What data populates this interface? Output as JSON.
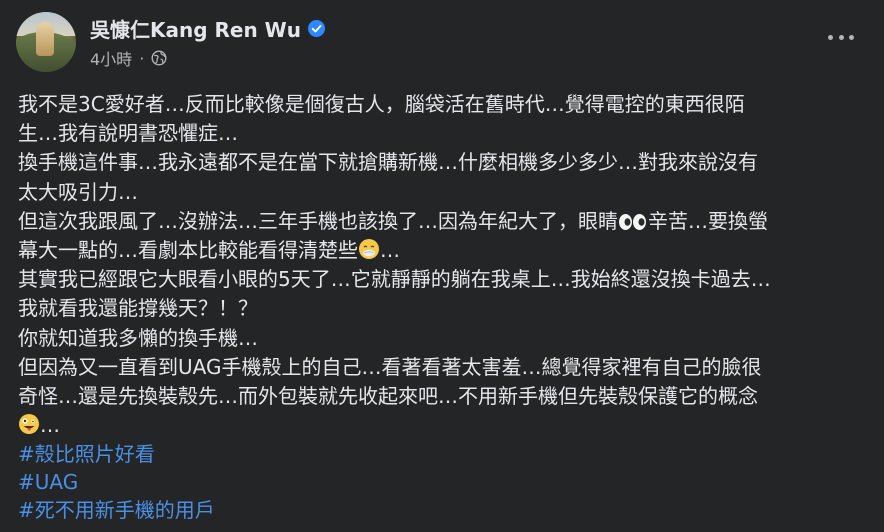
{
  "post": {
    "author": "吳慷仁Kang Ren Wu",
    "verified_icon": "verified-badge-icon",
    "timestamp": "4小時",
    "separator": "·",
    "audience_icon": "globe-icon",
    "more_icon": "more-options-icon",
    "lines": [
      "我不是3C愛好者…反而比較像是個復古人，腦袋活在舊時代…覺得電控的東西很陌",
      "生…我有說明書恐懼症…",
      "換手機這件事…我永遠都不是在當下就搶購新機…什麼相機多少多少…對我來說沒有",
      "太大吸引力…",
      "但這次我跟風了…沒辦法…三年手機也該換了…因為年紀大了，眼睛",
      "辛苦…要換螢",
      "幕大一點的…看劇本比較能看得清楚些",
      "…",
      "其實我已經跟它大眼看小眼的5天了…它就靜靜的躺在我桌上…我始終還沒換卡過去…",
      "我就看我還能撐幾天？！？",
      "你就知道我多懶的換手機…",
      "但因為又一直看到UAG手機殼上的自己…看著看著太害羞…總覺得家裡有自己的臉很",
      "奇怪…還是先換裝殼先…而外包裝就先收起來吧…不用新手機但先裝殼保護它的概念",
      "…"
    ],
    "emojis": [
      "eyes-emoji",
      "face-exhaling-emoji",
      "zany-face-emoji"
    ],
    "hashtags": [
      "#殼比照片好看",
      "#UAG",
      "#死不用新手機的用戶"
    ]
  },
  "colors": {
    "background": "#242526",
    "text": "#e4e6eb",
    "secondary": "#b0b3b8",
    "link": "#4a90e6",
    "verified": "#2d88ff"
  }
}
